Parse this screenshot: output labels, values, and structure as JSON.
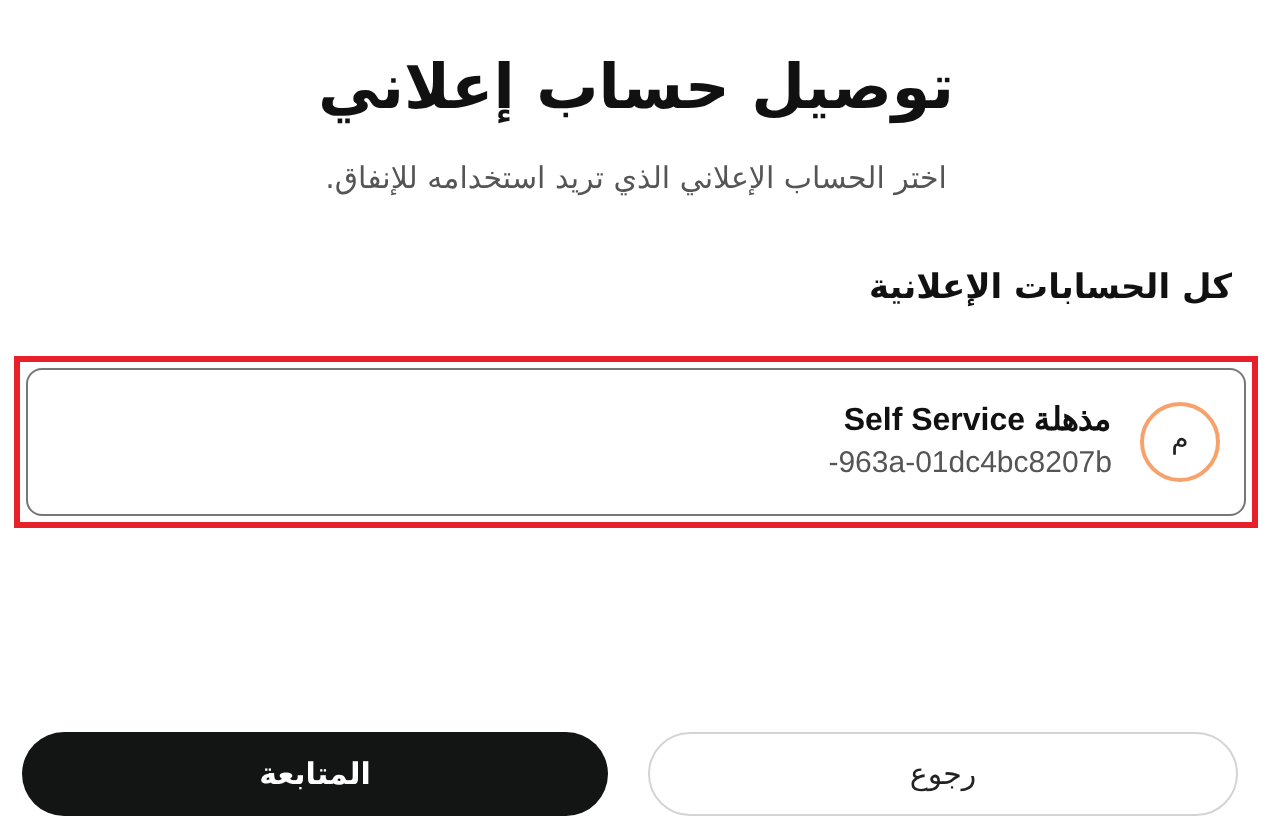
{
  "title": "توصيل حساب إعلاني",
  "subtitle": "اختر الحساب الإعلاني الذي تريد استخدامه للإنفاق.",
  "section_heading": "كل الحسابات الإعلانية",
  "accounts": [
    {
      "initial": "م",
      "name": "مذهلة Self Service",
      "id": "-963a-01dc4bc8207b",
      "selected": true
    }
  ],
  "buttons": [
    {
      "label": "رجوع",
      "kind": "secondary"
    },
    {
      "label": "المتابعة",
      "kind": "primary"
    }
  ]
}
